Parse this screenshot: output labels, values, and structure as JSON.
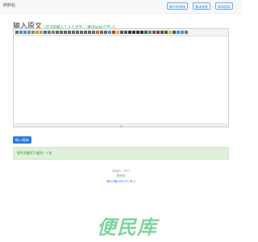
{
  "header": {
    "brand": "胖胖帖",
    "nav": [
      "繁中转简体",
      "繁体搜索",
      "简体搜索"
    ]
  },
  "editor_section": {
    "title": "输入原文",
    "hint": "[ 您当前输入了 0 个文字。（最多5000个字。）]",
    "toolbar_icons": [
      {
        "name": "source",
        "color": "#6b6b6b"
      },
      {
        "name": "undo",
        "color": "#4a8fd8"
      },
      {
        "name": "redo",
        "color": "#4a8fd8"
      },
      {
        "name": "cut",
        "color": "#888888"
      },
      {
        "name": "copy",
        "color": "#888888"
      },
      {
        "name": "paste",
        "color": "#c79a3a"
      },
      {
        "name": "paste-text",
        "color": "#c79a3a"
      },
      {
        "name": "paste-word",
        "color": "#3b6fc4"
      },
      {
        "name": "print",
        "color": "#777777"
      },
      {
        "name": "spellcheck",
        "color": "#5aa05a"
      },
      {
        "name": "align-left",
        "color": "#666666"
      },
      {
        "name": "align-center",
        "color": "#666666"
      },
      {
        "name": "align-right",
        "color": "#666666"
      },
      {
        "name": "justify",
        "color": "#666666"
      },
      {
        "name": "ordered-list",
        "color": "#666666"
      },
      {
        "name": "unordered-list",
        "color": "#666666"
      },
      {
        "name": "indent",
        "color": "#666666"
      },
      {
        "name": "outdent",
        "color": "#666666"
      },
      {
        "name": "subscript",
        "color": "#666666"
      },
      {
        "name": "superscript",
        "color": "#666666"
      },
      {
        "name": "clear-format",
        "color": "#d36a2a"
      },
      {
        "name": "select-all",
        "color": "#666666"
      },
      {
        "name": "find",
        "color": "#666666"
      },
      {
        "name": "fullscreen",
        "color": "#4a8fd8"
      },
      {
        "name": "text-color",
        "color": "#c0392b"
      },
      {
        "name": "bg-color",
        "color": "#e6b422"
      },
      {
        "name": "font",
        "color": "#555555"
      },
      {
        "name": "font-size",
        "color": "#555555"
      },
      {
        "name": "bold",
        "color": "#333333"
      },
      {
        "name": "italic",
        "color": "#333333"
      },
      {
        "name": "underline",
        "color": "#333333"
      },
      {
        "name": "strikethrough",
        "color": "#333333"
      },
      {
        "name": "line-height",
        "color": "#555555"
      },
      {
        "name": "image",
        "color": "#3d9a5b"
      },
      {
        "name": "flash",
        "color": "#c0392b"
      },
      {
        "name": "media",
        "color": "#555555"
      },
      {
        "name": "table",
        "color": "#555555"
      },
      {
        "name": "hr",
        "color": "#555555"
      },
      {
        "name": "emoticons",
        "color": "#e6b422"
      },
      {
        "name": "special-char",
        "color": "#555555"
      },
      {
        "name": "link",
        "color": "#4a8fd8"
      },
      {
        "name": "unlink",
        "color": "#4a8fd8"
      },
      {
        "name": "about",
        "color": "#777777"
      }
    ],
    "textarea_value": ""
  },
  "convert_button": "转>>简体",
  "result": {
    "text": "您今天使用了0超作：0 次"
  },
  "footer": {
    "line1": "本站为 - 2017",
    "line2": "胖胖帖",
    "link": "湘ICP备19007727号-1"
  },
  "watermark": "便民库"
}
